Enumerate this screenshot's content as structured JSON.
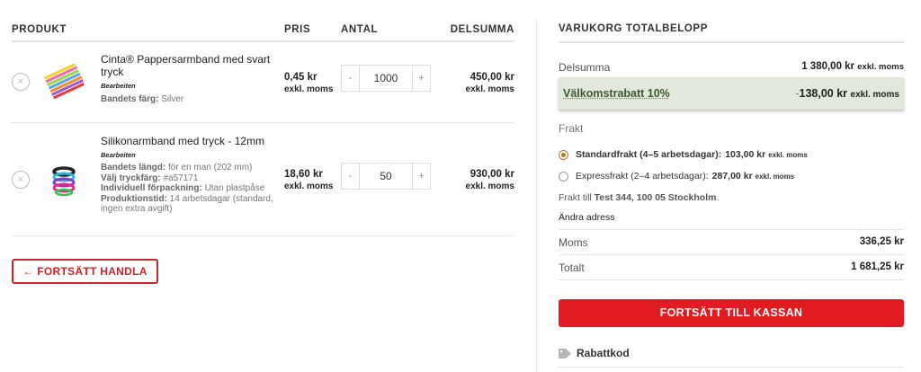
{
  "cart": {
    "headers": {
      "product": "PRODUKT",
      "price": "PRIS",
      "qty": "ANTAL",
      "subtotal": "DELSUMMA"
    },
    "items": [
      {
        "name": "Cinta® Pappersarmband med svart tryck",
        "edit": "Bearbeiten",
        "meta": [
          {
            "label": "Bandets färg:",
            "value": "Silver"
          }
        ],
        "price": "0,45 kr",
        "price_note": "exkl. moms",
        "qty": "1000",
        "subtotal": "450,00 kr",
        "subtotal_note": "exkl. moms"
      },
      {
        "name": "Silikonarmband med tryck - 12mm",
        "edit": "Bearbeiten",
        "meta": [
          {
            "label": "Bandets längd:",
            "value": "för en man (202 mm)"
          },
          {
            "label": "Välj tryckfärg:",
            "value": "#a57171"
          },
          {
            "label": "Individuell förpackning:",
            "value": "Utan plastpåse"
          },
          {
            "label": "Produktionstid:",
            "value": "14 arbetsdagar (standard, ingen extra avgift)"
          }
        ],
        "price": "18,60 kr",
        "price_note": "exkl. moms",
        "qty": "50",
        "subtotal": "930,00 kr",
        "subtotal_note": "exkl. moms"
      }
    ],
    "remove_icon": "×",
    "minus": "-",
    "plus": "+",
    "continue_label": "← FORTSÄTT HANDLA"
  },
  "totals": {
    "title": "VARUKORG TOTALBELOPP",
    "subtotal_label": "Delsumma",
    "subtotal_value": "1 380,00 kr",
    "subtotal_note": "exkl. moms",
    "discount_label": "Välkomstrabatt 10%",
    "discount_sign": "-",
    "discount_value": "138,00 kr",
    "discount_note": "exkl. moms",
    "shipping_label": "Frakt",
    "shipping_options": [
      {
        "label": "Standardfrakt (4–5 arbetsdagar):",
        "price": "103,00 kr",
        "note": "exkl. moms",
        "selected": true
      },
      {
        "label": "Expressfrakt (2–4 arbetsdagar):",
        "price": "287,00 kr",
        "note": "exkl. moms",
        "selected": false
      }
    ],
    "ship_to": "Frakt till",
    "ship_to_address": "Test 344, 100 05 Stockholm",
    "change_address": "Ändra adress",
    "vat_label": "Moms",
    "vat_value": "336,25 kr",
    "total_label": "Totalt",
    "total_value": "1 681,25 kr",
    "checkout_label": "FORTSÄTT TILL KASSAN",
    "coupon_label": "Rabattkod"
  },
  "colors": {
    "accent_red": "#e11b22",
    "discount_bg": "#e3e8dd",
    "radio_selected": "#b37a1f"
  }
}
